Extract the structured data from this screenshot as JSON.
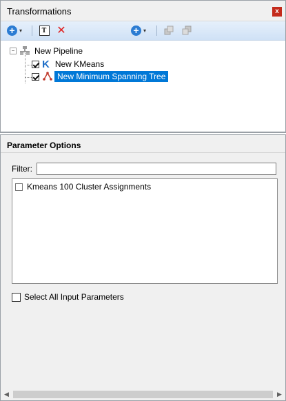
{
  "top_panel": {
    "title": "Transformations",
    "close_glyph": "x",
    "toolbar": {
      "add_glyph": "+",
      "caret_glyph": "▾",
      "text_glyph": "T",
      "delete_glyph": "✕",
      "add2_glyph": "+"
    },
    "tree": {
      "expander_glyph": "−",
      "root_label": "New Pipeline",
      "kmeans_glyph": "K",
      "items": [
        {
          "label": "New KMeans",
          "checked": true,
          "icon": "kmeans-icon"
        },
        {
          "label": "New Minimum Spanning Tree",
          "checked": true,
          "icon": "spanning-tree-icon",
          "selected": true
        }
      ]
    }
  },
  "bottom_panel": {
    "title": "Parameter Options",
    "filter_label": "Filter:",
    "filter_value": "",
    "list_items": [
      {
        "label": "Kmeans 100 Cluster Assignments",
        "checked": false
      }
    ],
    "select_all_label": "Select All Input Parameters",
    "scroll_left_glyph": "◀",
    "scroll_right_glyph": "▶"
  },
  "colors": {
    "accent": "#0078d7",
    "close_red": "#c42b1c",
    "toolbar_blue": "#2b7cd3",
    "delete_red": "#e02020"
  }
}
